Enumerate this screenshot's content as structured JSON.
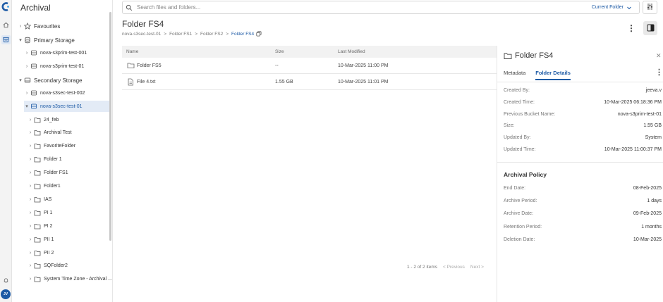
{
  "app": {
    "title": "Archival",
    "user_initials": "JV"
  },
  "tree": {
    "favourites": "Favourites",
    "primary": "Primary Storage",
    "primary_buckets": [
      "nova-s3prim-test-001",
      "nova-s3prim-test-01"
    ],
    "secondary": "Secondary Storage",
    "secondary_buckets": [
      "nova-s3sec-test-002",
      "nova-s3sec-test-01"
    ],
    "folders": [
      "24_feb",
      "Archival Test",
      "FavoriteFolder",
      "Folder 1",
      "Folder FS1",
      "Folder1",
      "IAS",
      "PI 1",
      "PI 2",
      "PII 1",
      "PII 2",
      "SQFolder2",
      "System Time Zone - Archival ..."
    ]
  },
  "search": {
    "placeholder": "Search files and folders...",
    "scope": "Current Folder"
  },
  "header": {
    "title": "Folder FS4",
    "breadcrumb": [
      "nova-s3sec-test-01",
      "Folder FS1",
      "Folder FS2",
      "Folder FS4"
    ]
  },
  "table": {
    "columns": [
      "Name",
      "Size",
      "Last Modified"
    ],
    "rows": [
      {
        "name": "Folder FS5",
        "size": "--",
        "modified": "10-Mar-2025 11:00 PM",
        "icon": "folder-icon"
      },
      {
        "name": "File 4.txt",
        "size": "1.55 GB",
        "modified": "10-Mar-2025 11:01 PM",
        "icon": "file-icon"
      }
    ]
  },
  "pager": {
    "summary": "1 - 2 of 2 items",
    "prev": "< Previous",
    "next": "Next >"
  },
  "details": {
    "title": "Folder FS4",
    "tabs": [
      "Metadata",
      "Folder Details"
    ],
    "fields": [
      {
        "k": "Created By:",
        "v": "jeeva.v"
      },
      {
        "k": "Created Time:",
        "v": "10-Mar-2025 06:18:36 PM"
      },
      {
        "k": "Previous Bucket Name:",
        "v": "nova-s3prim-test-01"
      },
      {
        "k": "Size:",
        "v": "1.55 GB"
      },
      {
        "k": "Updated By:",
        "v": "System"
      },
      {
        "k": "Updated Time:",
        "v": "10-Mar-2025 11:00:37 PM"
      }
    ],
    "policy_title": "Archival Policy",
    "policy": [
      {
        "k": "End Date:",
        "v": "08-Feb-2025"
      },
      {
        "k": "Archive Period:",
        "v": "1 days"
      },
      {
        "k": "Archive Date:",
        "v": "09-Feb-2025"
      },
      {
        "k": "Retention Period:",
        "v": "1 months"
      },
      {
        "k": "Deletion Date:",
        "v": "10-Mar-2025"
      }
    ]
  },
  "colors": {
    "accent": "#1d5aa5",
    "selected_bg": "#e3ebf6"
  }
}
